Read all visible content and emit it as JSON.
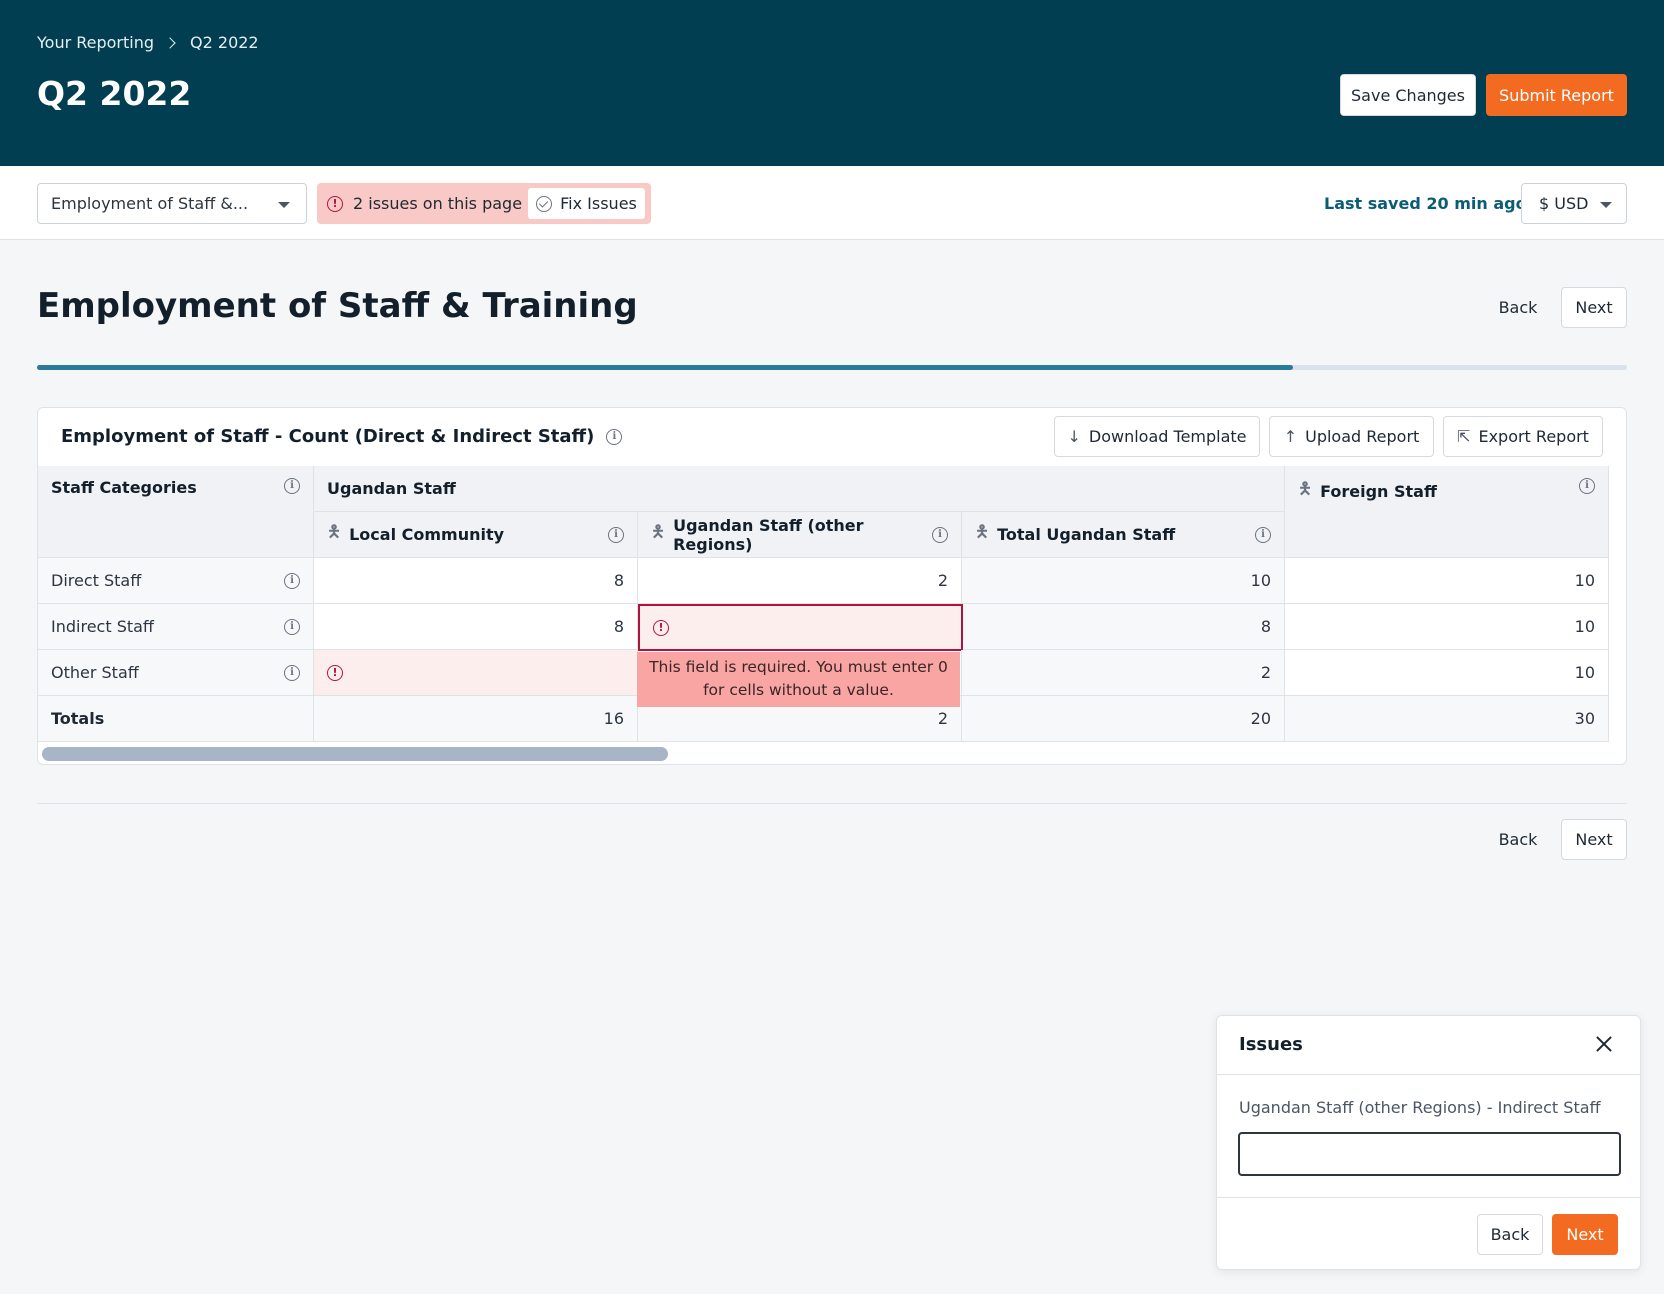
{
  "header": {
    "breadcrumb": [
      "Your Reporting",
      "Q2 2022"
    ],
    "title": "Q2 2022",
    "save_label": "Save Changes",
    "submit_label": "Submit Report"
  },
  "toolbar": {
    "section_select": "Employment of Staff &...",
    "issues_text": "2 issues on this page",
    "fix_label": "Fix Issues",
    "last_saved": "Last saved 20 min ago",
    "currency": "$ USD"
  },
  "section": {
    "title": "Employment of Staff & Training",
    "back_label": "Back",
    "next_label": "Next",
    "progress": 0.79
  },
  "card": {
    "title": "Employment of Staff - Count (Direct & Indirect Staff)",
    "download_label": "Download Template",
    "upload_label": "Upload Report",
    "export_label": "Export Report"
  },
  "table": {
    "corner_header": "Staff Categories",
    "group_header": "Ugandan Staff",
    "columns": [
      "Local Community",
      "Ugandan Staff (other Regions)",
      "Total Ugandan Staff",
      "Foreign Staff"
    ],
    "rows": [
      {
        "label": "Direct Staff",
        "values": [
          "8",
          "2",
          "10",
          "10"
        ]
      },
      {
        "label": "Indirect Staff",
        "values": [
          "8",
          "",
          "8",
          "10"
        ]
      },
      {
        "label": "Other Staff",
        "values": [
          "",
          "",
          "2",
          "10"
        ]
      }
    ],
    "totals": {
      "label": "Totals",
      "values": [
        "16",
        "2",
        "20",
        "30"
      ]
    }
  },
  "tooltip": "This field is required. You must enter 0 for cells without a value.",
  "colors": {
    "header_bg": "#013e52",
    "accent": "#f26b21",
    "error": "#b0143d",
    "progress": "#2b7a99"
  },
  "issues_panel": {
    "title": "Issues",
    "field_label": "Ugandan Staff (other Regions) - Indirect Staff",
    "input_value": "",
    "back_label": "Back",
    "next_label": "Next"
  }
}
